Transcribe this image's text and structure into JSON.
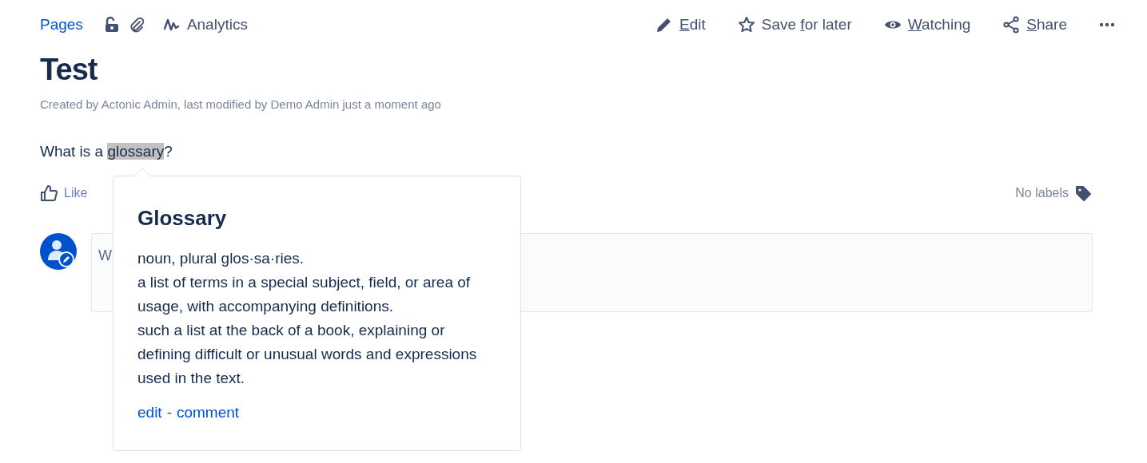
{
  "breadcrumb": {
    "pages_link": "Pages",
    "analytics": "Analytics"
  },
  "actions": [
    {
      "kind": "edit",
      "key": "E",
      "after": "dit"
    },
    {
      "kind": "save",
      "before": "Save ",
      "key": "f",
      "after": "or later"
    },
    {
      "kind": "watch",
      "key": "W",
      "after": "atching"
    },
    {
      "kind": "share",
      "key": "S",
      "after": "hare"
    },
    {
      "kind": "more"
    }
  ],
  "page": {
    "title": "Test",
    "byline": "Created by Actonic Admin, last modified by Demo Admin just a moment ago",
    "body": {
      "before": "What is a ",
      "term": "glossary",
      "after": "?"
    }
  },
  "like": "Like",
  "labels": "No labels",
  "comment_box": {
    "placeholder": "W"
  },
  "popover": {
    "title": "Glossary",
    "lines": [
      "noun, plural glos·sa·ries.",
      "a list of terms in a special subject, field, or area of usage, with accompanying definitions.",
      "such a list at the back of a book, explaining or defining difficult or unusual words and expressions used in the text."
    ],
    "edit_link": "edit",
    "separator": "-",
    "comment_link": "comment"
  }
}
